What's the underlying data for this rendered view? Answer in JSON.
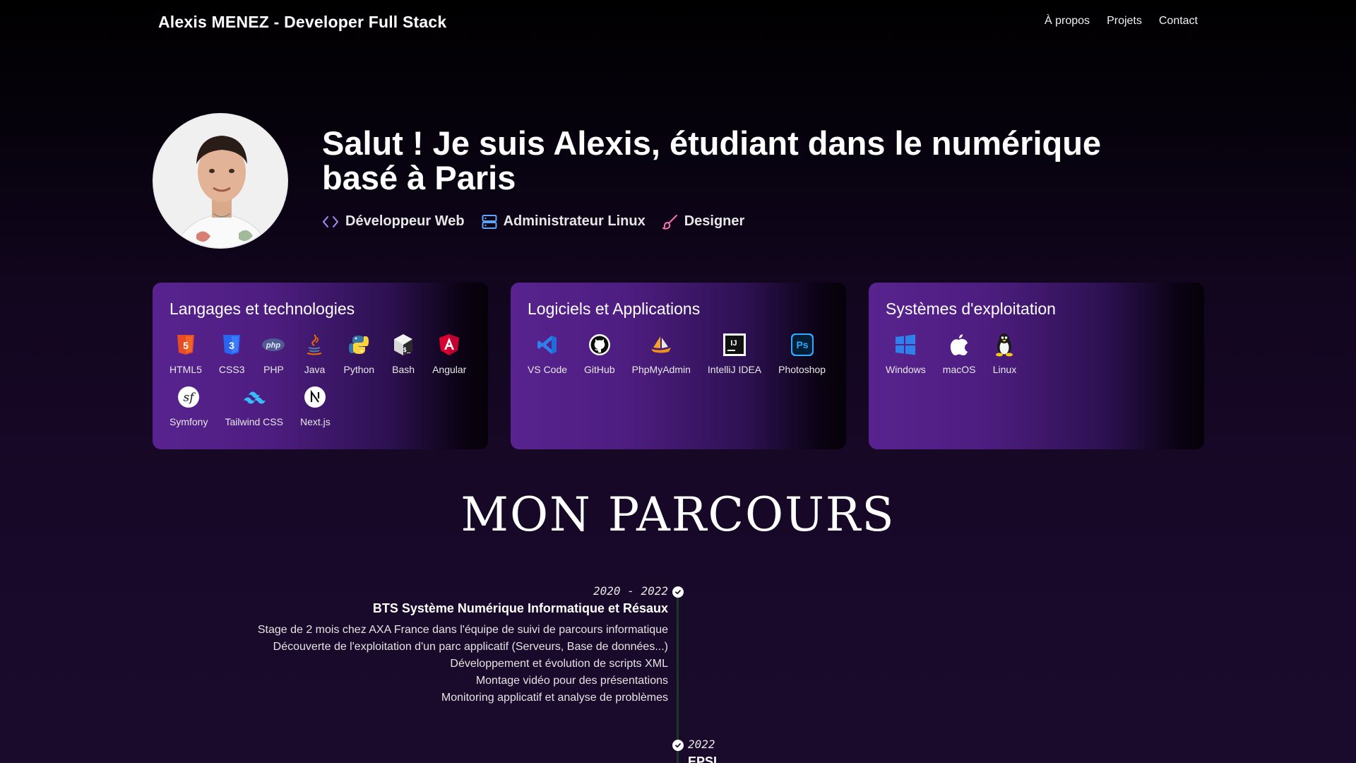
{
  "nav": {
    "brand": "Alexis MENEZ - Developer Full Stack",
    "links": [
      "À propos",
      "Projets",
      "Contact"
    ]
  },
  "hero": {
    "avatar_icon": "portrait-photo",
    "title": "Salut ! Je suis Alexis, étudiant dans le numérique basé à Paris",
    "roles": [
      {
        "label": "Développeur Web",
        "icon": "code-icon",
        "color": "#a78bfa"
      },
      {
        "label": "Administrateur Linux",
        "icon": "server-icon",
        "color": "#60a5fa"
      },
      {
        "label": "Designer",
        "icon": "brush-icon",
        "color": "#f472b6"
      }
    ]
  },
  "cards": [
    {
      "title": "Langages et technologies",
      "items": [
        {
          "label": "HTML5",
          "icon": "html5-icon",
          "color": "#e44d26"
        },
        {
          "label": "CSS3",
          "icon": "css3-icon",
          "color": "#2965f1"
        },
        {
          "label": "PHP",
          "icon": "php-icon",
          "color": "#8892bf"
        },
        {
          "label": "Java",
          "icon": "java-icon",
          "color": "#e76f00"
        },
        {
          "label": "Python",
          "icon": "python-icon",
          "color": "#ffd43b"
        },
        {
          "label": "Bash",
          "icon": "bash-icon",
          "color": "#ffffff"
        },
        {
          "label": "Angular",
          "icon": "angular-icon",
          "color": "#dd0031"
        },
        {
          "label": "Symfony",
          "icon": "symfony-icon",
          "color": "#ffffff"
        },
        {
          "label": "Tailwind CSS",
          "icon": "tailwind-icon",
          "color": "#38bdf8"
        },
        {
          "label": "Next.js",
          "icon": "nextjs-icon",
          "color": "#ffffff"
        }
      ]
    },
    {
      "title": "Logiciels et Applications",
      "items": [
        {
          "label": "VS Code",
          "icon": "vscode-icon",
          "color": "#2f80ed"
        },
        {
          "label": "GitHub",
          "icon": "github-icon",
          "color": "#000000"
        },
        {
          "label": "PhpMyAdmin",
          "icon": "phpmyadmin-icon",
          "color": "#f29111"
        },
        {
          "label": "IntelliJ IDEA",
          "icon": "intellij-icon",
          "color": "#ffffff"
        },
        {
          "label": "Photoshop",
          "icon": "photoshop-icon",
          "color": "#31a8ff"
        }
      ]
    },
    {
      "title": "Systèmes d'exploitation",
      "items": [
        {
          "label": "Windows",
          "icon": "windows-icon",
          "color": "#2f80ed"
        },
        {
          "label": "macOS",
          "icon": "apple-icon",
          "color": "#ffffff"
        },
        {
          "label": "Linux",
          "icon": "linux-icon",
          "color": "#f5c518"
        }
      ]
    }
  ],
  "parcours": {
    "title": "MON PARCOURS",
    "entries": [
      {
        "date": "2020 - 2022",
        "heading": "BTS Système Numérique Informatique et Résaux",
        "lines": [
          "Stage de 2 mois chez AXA France dans l'équipe de suivi de parcours informatique",
          "Découverte de l'exploitation d'un parc applicatif (Serveurs, Base de données...)",
          "Développement et évolution de scripts XML",
          "Montage vidéo pour des présentations",
          "Monitoring applicatif et analyse de problèmes"
        ]
      },
      {
        "date": "2022",
        "heading": "EPSI"
      }
    ]
  }
}
